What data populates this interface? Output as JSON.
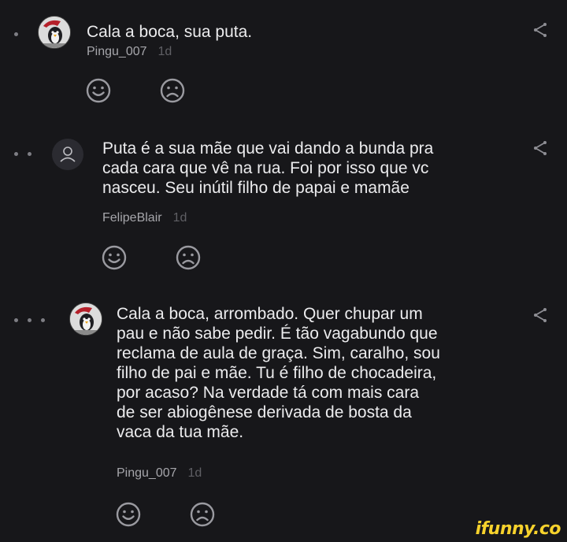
{
  "comments": [
    {
      "depth": 1,
      "text": "Cala a boca, sua puta.",
      "author": "Pingu_007",
      "time": "1d",
      "avatar_icon": "penguin-avatar-icon"
    },
    {
      "depth": 2,
      "text": "Puta é a sua mãe que vai dando a bunda pra\ncada cara que vê na rua. Foi por isso que vc\nnasceu. Seu inútil filho de papai e mamãe",
      "author": "FelipeBlair",
      "time": "1d",
      "avatar_icon": "default-user-icon"
    },
    {
      "depth": 3,
      "text": "Cala a boca, arrombado. Quer chupar um\npau e não sabe pedir. É tão vagabundo que\nreclama de aula de graça. Sim, caralho, sou\nfilho de pai e mãe. Tu é filho de chocadeira,\npor acaso? Na verdade tá com mais cara\nde ser abiogênese derivada de bosta da\nvaca da tua mãe.",
      "author": "Pingu_007",
      "time": "1d",
      "avatar_icon": "penguin-avatar-icon"
    }
  ],
  "icons": {
    "share": "share-icon",
    "like": "smile-icon",
    "dislike": "frown-icon"
  },
  "watermark": "ifunny.co",
  "colors": {
    "background": "#17171a",
    "text": "#ececee",
    "meta": "#a6a6ab",
    "time": "#5f5f64",
    "icon": "#9a9aa0",
    "brand": "#f7d22c"
  }
}
